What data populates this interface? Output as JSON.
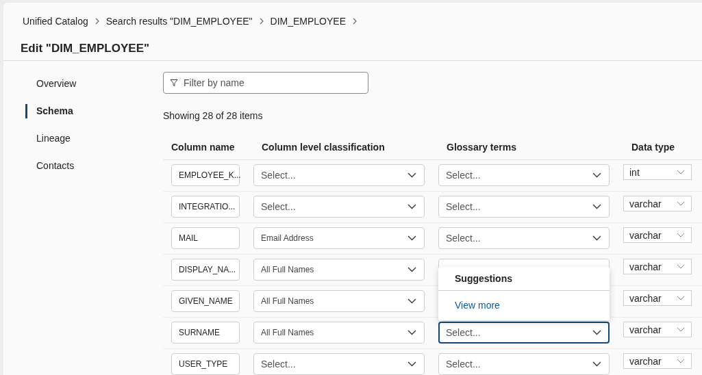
{
  "breadcrumb": [
    {
      "label": "Unified Catalog"
    },
    {
      "label": "Search results \"DIM_EMPLOYEE\""
    },
    {
      "label": "DIM_EMPLOYEE"
    }
  ],
  "title": "Edit \"DIM_EMPLOYEE\"",
  "nav": [
    {
      "label": "Overview",
      "selected": false
    },
    {
      "label": "Schema",
      "selected": true
    },
    {
      "label": "Lineage",
      "selected": false
    },
    {
      "label": "Contacts",
      "selected": false
    }
  ],
  "filter": {
    "placeholder": "Filter by name"
  },
  "count": "Showing 28 of 28 items",
  "table": {
    "columns": [
      "Column name",
      "Column level classification",
      "Glossary terms",
      "Data type"
    ],
    "rows": [
      {
        "name": "EMPLOYEE_K...",
        "classification": {
          "placeholder": "Select..."
        },
        "glossary": {
          "placeholder": "Select...",
          "focused": false
        },
        "data_type": "int"
      },
      {
        "name": "INTEGRATIO...",
        "classification": {
          "placeholder": "Select..."
        },
        "glossary": {
          "placeholder": "Select...",
          "focused": false
        },
        "data_type": "varchar"
      },
      {
        "name": "MAIL",
        "classification": {
          "value": "Email Address"
        },
        "glossary": {
          "placeholder": "Select...",
          "focused": false
        },
        "data_type": "varchar"
      },
      {
        "name": "DISPLAY_NA...",
        "classification": {
          "value": "All Full Names"
        },
        "glossary": {
          "focused": false
        },
        "data_type": "varchar"
      },
      {
        "name": "GIVEN_NAME",
        "classification": {
          "value": "All Full Names"
        },
        "data_type": "varchar"
      },
      {
        "name": "SURNAME",
        "classification": {
          "value": "All Full Names"
        },
        "glossary": {
          "placeholder": "Select...",
          "focused": true
        },
        "data_type": "varchar"
      },
      {
        "name": "USER_TYPE",
        "classification": {
          "placeholder": "Select..."
        },
        "glossary": {
          "placeholder": "Select...",
          "focused": false
        },
        "data_type": "varchar"
      }
    ]
  },
  "suggestions": {
    "heading": "Suggestions",
    "link": "View more"
  }
}
